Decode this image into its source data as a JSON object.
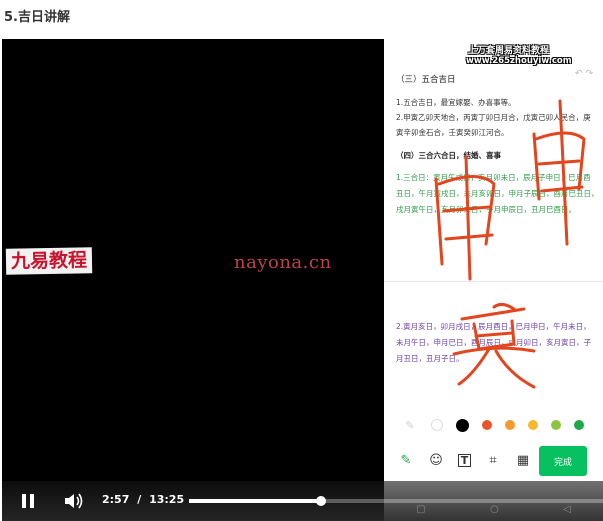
{
  "heading": "5.吉日讲解",
  "watermarks": {
    "left": "九易教程",
    "center": "nayona.cn"
  },
  "phone": {
    "site_title": "上万套周易资料教程",
    "site_url": "www.265zhouyiw.com",
    "doc": {
      "section3_title": "（三）五合吉日",
      "s3_line1": "1.五合吉日，最宜嫁娶、办喜事等。",
      "s3_line2": "2.甲寅乙卯天地合，丙寅丁卯日月合，戊寅己卯人民合，庚",
      "s3_line3": "寅辛卯金石合，壬寅癸卯江河合。",
      "section4_title": "（四）三合六合日，结婚、喜事",
      "s4_line1": "1.三合日：寅月午戌日，亥月卯未日，辰月子申日，巳月酉",
      "s4_line2": "丑日，午月寅戌日，未月亥卯日，申月子辰日，酉月巳丑日，",
      "s4_line3": "戌月寅午日，亥月卯未日，子月申辰日，丑月巳酉日。",
      "s5_line1": "2.寅月亥日，卯月戌日，辰月酉日，巳月申日，午月未日，",
      "s5_line2": "未月午日，申月巳日，酉月辰日，戌月卯日，亥月寅日，子",
      "s5_line3": "月丑日，丑月子日。"
    },
    "palette": [
      "#ffffff",
      "#000000",
      "#e8552a",
      "#f39c2b",
      "#f5b82e",
      "#8cc63f",
      "#1ea84a"
    ],
    "done_label": "完成"
  },
  "player": {
    "current_time": "2:57",
    "separator": "/",
    "duration": "13:25",
    "progress": 0.32
  }
}
